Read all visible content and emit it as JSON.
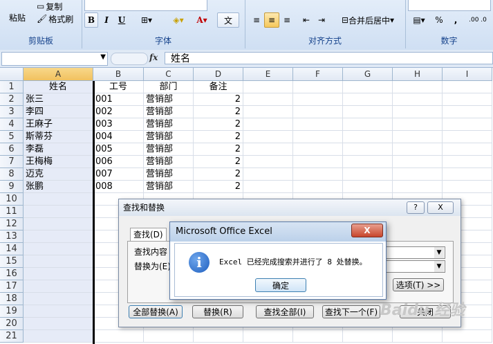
{
  "ribbon": {
    "clipboard": {
      "paste": "粘贴",
      "copy": "复制",
      "format_painter": "格式刷",
      "label": "剪贴板"
    },
    "font": {
      "label": "字体",
      "bold": "B",
      "italic": "I",
      "underline": "U",
      "font_color": "A",
      "phonetic": "文"
    },
    "alignment": {
      "label": "对齐方式",
      "merge_center": "合并后居中"
    },
    "number": {
      "label": "数字",
      "percent": "%",
      "comma": ","
    }
  },
  "formula_bar": {
    "fx": "fx",
    "content": "姓名"
  },
  "columns": [
    "A",
    "B",
    "C",
    "D",
    "E",
    "F",
    "G",
    "H",
    "I"
  ],
  "rows": [
    "1",
    "2",
    "3",
    "4",
    "5",
    "6",
    "7",
    "8",
    "9",
    "10",
    "11",
    "12",
    "13",
    "14",
    "15",
    "16",
    "17",
    "18",
    "19",
    "20",
    "21"
  ],
  "table": {
    "header": [
      "姓名",
      "工号",
      "部门",
      "备注"
    ],
    "data": [
      [
        "张三",
        "001",
        "营销部",
        "2"
      ],
      [
        "李四",
        "002",
        "营销部",
        "2"
      ],
      [
        "王麻子",
        "003",
        "营销部",
        "2"
      ],
      [
        "斯蒂芬",
        "004",
        "营销部",
        "2"
      ],
      [
        "李磊",
        "005",
        "营销部",
        "2"
      ],
      [
        "王梅梅",
        "006",
        "营销部",
        "2"
      ],
      [
        "迈克",
        "007",
        "营销部",
        "2"
      ],
      [
        "张鹏",
        "008",
        "营销部",
        "2"
      ]
    ]
  },
  "find_dialog": {
    "title": "查找和替换",
    "help": "?",
    "close": "X",
    "tab_find": "查找(D)",
    "find_label": "查找内容",
    "replace_label": "替换为(E)",
    "options": "选项(T) >>",
    "replace_all": "全部替换(A)",
    "replace": "替换(R)",
    "find_all": "查找全部(I)",
    "find_next": "查找下一个(F)",
    "close_btn": "关闭"
  },
  "message_box": {
    "title": "Microsoft Office Excel",
    "close": "X",
    "icon": "i",
    "text": "Excel 已经完成搜索并进行了 8 处替换。",
    "ok": "确定"
  },
  "watermark": "Baidu 经验"
}
